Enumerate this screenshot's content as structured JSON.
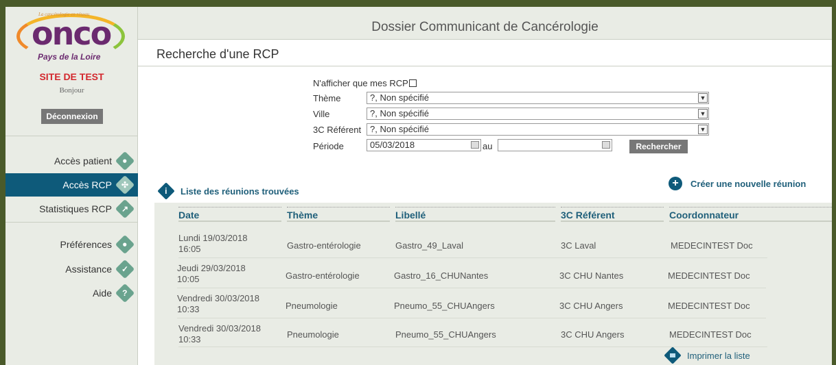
{
  "logo": {
    "tagline": "La cancérologie en réseau",
    "main": "onco",
    "sub": "Pays de la Loire"
  },
  "sidebar": {
    "site": "SITE DE TEST",
    "greeting": "Bonjour",
    "logout": "Déconnexion",
    "items": [
      {
        "label": "Accès patient",
        "icon": "user-icon",
        "active": false
      },
      {
        "label": "Accès RCP",
        "icon": "group-icon",
        "active": true
      },
      {
        "label": "Statistiques RCP",
        "icon": "chart-icon",
        "active": false
      },
      {
        "label": "Préférences",
        "icon": "preferences-icon",
        "active": false
      },
      {
        "label": "Assistance",
        "icon": "assistance-icon",
        "active": false
      },
      {
        "label": "Aide",
        "icon": "help-icon",
        "active": false
      }
    ]
  },
  "header": {
    "title": "Dossier Communicant de Cancérologie",
    "page_title": "Recherche d'une RCP"
  },
  "form": {
    "only_mine_label": "N'afficher que mes RCP",
    "theme_label": "Thème",
    "theme_value": "?, Non spécifié",
    "city_label": "Ville",
    "city_value": "?, Non spécifié",
    "ref_label": "3C Référent",
    "ref_value": "?, Non spécifié",
    "period_label": "Période",
    "period_from": "05/03/2018",
    "period_to_label": "au",
    "period_to": "",
    "search_button": "Rechercher"
  },
  "list": {
    "title": "Liste des réunions trouvées",
    "create": "Créer une nouvelle réunion",
    "print": "Imprimer la liste",
    "columns": [
      "Date",
      "Thème",
      "Libellé",
      "3C Référent",
      "Coordonnateur"
    ],
    "rows": [
      {
        "date1": "Lundi 19/03/2018",
        "date2": "16:05",
        "theme": "Gastro-entérologie",
        "label": "Gastro_49_Laval",
        "ref": "3C Laval",
        "coord": "MEDECINTEST Doc"
      },
      {
        "date1": "Jeudi 29/03/2018",
        "date2": "10:05",
        "theme": "Gastro-entérologie",
        "label": "Gastro_16_CHUNantes",
        "ref": "3C CHU Nantes",
        "coord": "MEDECINTEST Doc"
      },
      {
        "date1": "Vendredi 30/03/2018",
        "date2": "10:33",
        "theme": "Pneumologie",
        "label": "Pneumo_55_CHUAngers",
        "ref": "3C CHU Angers",
        "coord": "MEDECINTEST Doc"
      },
      {
        "date1": "Vendredi 30/03/2018",
        "date2": "10:33",
        "theme": "Pneumologie",
        "label": "Pneumo_55_CHUAngers",
        "ref": "3C CHU Angers",
        "coord": "MEDECINTEST Doc"
      }
    ]
  }
}
